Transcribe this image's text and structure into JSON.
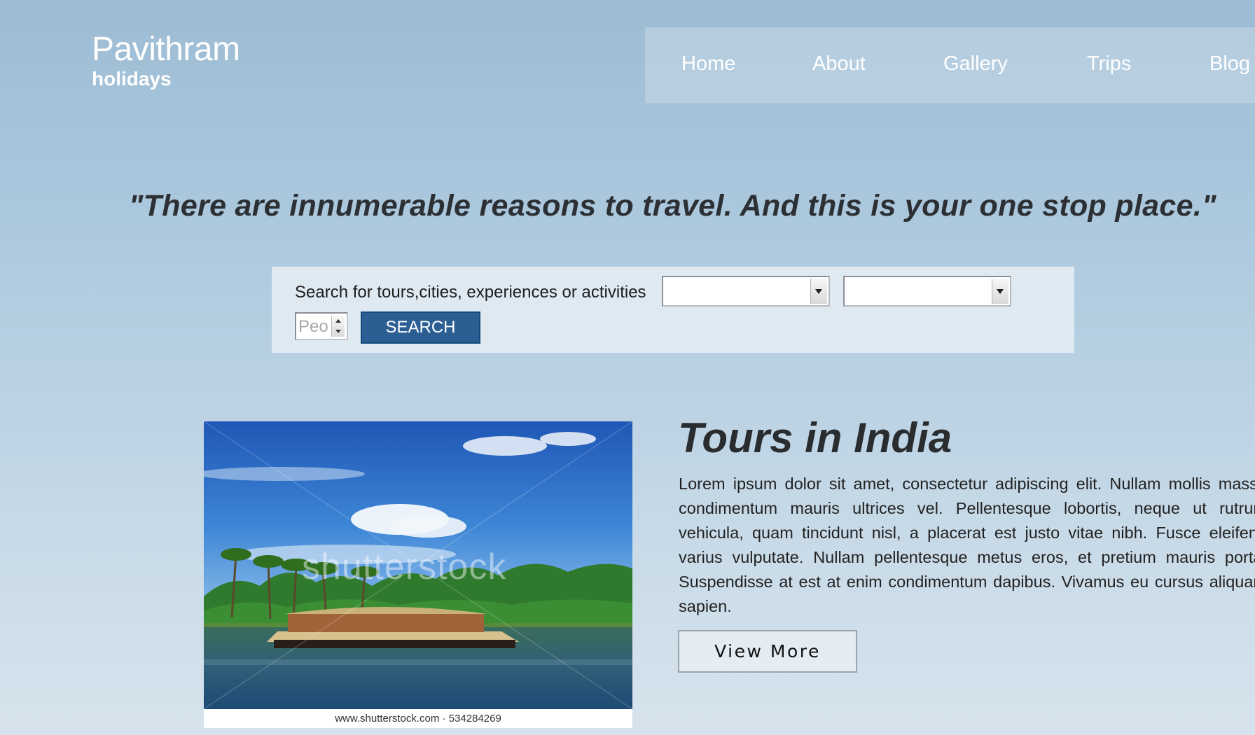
{
  "brand": {
    "name": "Pavithram",
    "tagline": "holidays"
  },
  "nav": {
    "items": [
      {
        "label": "Home"
      },
      {
        "label": "About"
      },
      {
        "label": "Gallery"
      },
      {
        "label": "Trips"
      },
      {
        "label": "Blog"
      }
    ]
  },
  "hero": {
    "quote": "\"There are innumerable reasons to travel. And this is your one stop place.\""
  },
  "search": {
    "label": "Search for tours,cities, experiences or activities",
    "select1_value": "",
    "select2_value": "",
    "people_placeholder": "People",
    "button_label": "SEARCH"
  },
  "feature": {
    "image_watermark": "shutterstock",
    "image_caption": "www.shutterstock.com · 534284269",
    "title": "Tours in India",
    "body": "Lorem ipsum dolor sit amet, consectetur adipiscing elit. Nullam mollis massa condimentum mauris ultrices vel. Pellentesque lobortis, neque ut rutrum vehicula, quam tincidunt nisl, a placerat est justo vitae nibh. Fusce eleifend varius vulputate. Nullam pellentesque metus eros, et pretium mauris porta. Suspendisse at est at enim condimentum dapibus. Vivamus eu cursus aliquam sapien.",
    "button_label": "View More"
  },
  "colors": {
    "search_button": "#2b5f93",
    "title_text": "#2a2d30"
  }
}
